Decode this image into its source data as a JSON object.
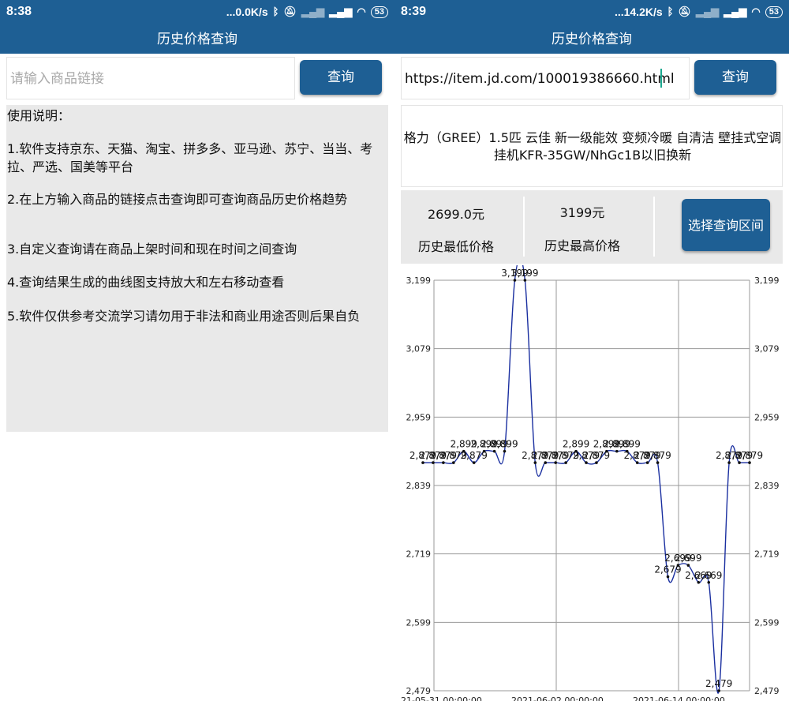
{
  "left": {
    "status": {
      "time": "8:38",
      "speed": "...0.0K/s",
      "battery": "53"
    },
    "title": "历史价格查询",
    "search": {
      "placeholder": "请输入商品链接",
      "button": "查询"
    },
    "help": {
      "title": "使用说明：",
      "items": [
        "1.软件支持京东、天猫、淘宝、拼多多、亚马逊、苏宁、当当、考拉、严选、国美等平台",
        "2.在上方输入商品的链接点击查询即可查询商品历史价格趋势",
        "3.自定义查询请在商品上架时间和现在时间之间查询",
        "4.查询结果生成的曲线图支持放大和左右移动查看",
        "5.软件仅供参考交流学习请勿用于非法和商业用途否则后果自负"
      ]
    }
  },
  "right": {
    "status": {
      "time": "8:39",
      "speed": "...14.2K/s",
      "battery": "53"
    },
    "title": "历史价格查询",
    "search": {
      "value": "https://item.jd.com/100019386660.html",
      "button": "查询"
    },
    "product_name": "格力（GREE）1.5匹 云佳 新一级能效 变频冷暖 自清洁 壁挂式空调挂机KFR-35GW/NhGc1B以旧换新",
    "lowest": {
      "value": "2699.0元",
      "label": "历史最低价格"
    },
    "highest": {
      "value": "3199元",
      "label": "历史最高价格"
    },
    "range_button": "选择查询区间"
  },
  "colors": {
    "bar": "#1e5f94",
    "line": "#1a2fa0",
    "panel": "#e9e9e9"
  },
  "chart_data": {
    "type": "line",
    "ylim": [
      2479,
      3199
    ],
    "yticks": [
      "3,199",
      "3,079",
      "2,959",
      "2,839",
      "2,719",
      "2,599",
      "2,479"
    ],
    "x_labels": [
      "21-05-31 00:00:00",
      "2021-06-02 00:00:00",
      "2021-06-14 00:00:00"
    ],
    "series": [
      {
        "values": [
          2879,
          2879,
          2879,
          2879,
          2899,
          2879,
          2899,
          2899,
          2899,
          3199,
          3199,
          2879,
          2879,
          2879,
          2879,
          2899,
          2879,
          2879,
          2899,
          2899,
          2899,
          2879,
          2879,
          2879,
          2679,
          2699,
          2699,
          2669,
          2669,
          2479,
          2879,
          2879,
          2879
        ],
        "labels": [
          "2,879",
          "2,879",
          "2,879",
          "2,879",
          "2,899",
          "2,879",
          "2,899",
          "2,899",
          "2,899",
          "3,199",
          "3,199",
          "2,879",
          "2,879",
          "2,879",
          "2,879",
          "2,899",
          "2,879",
          "2,879",
          "2,899",
          "2,899",
          "2,899",
          "2,879",
          "2,879",
          "2,879",
          "2,679",
          "2,699",
          "2,699",
          "2,669",
          "2,669",
          "2,479",
          "2,879",
          "2,879",
          "2,879"
        ]
      }
    ]
  }
}
